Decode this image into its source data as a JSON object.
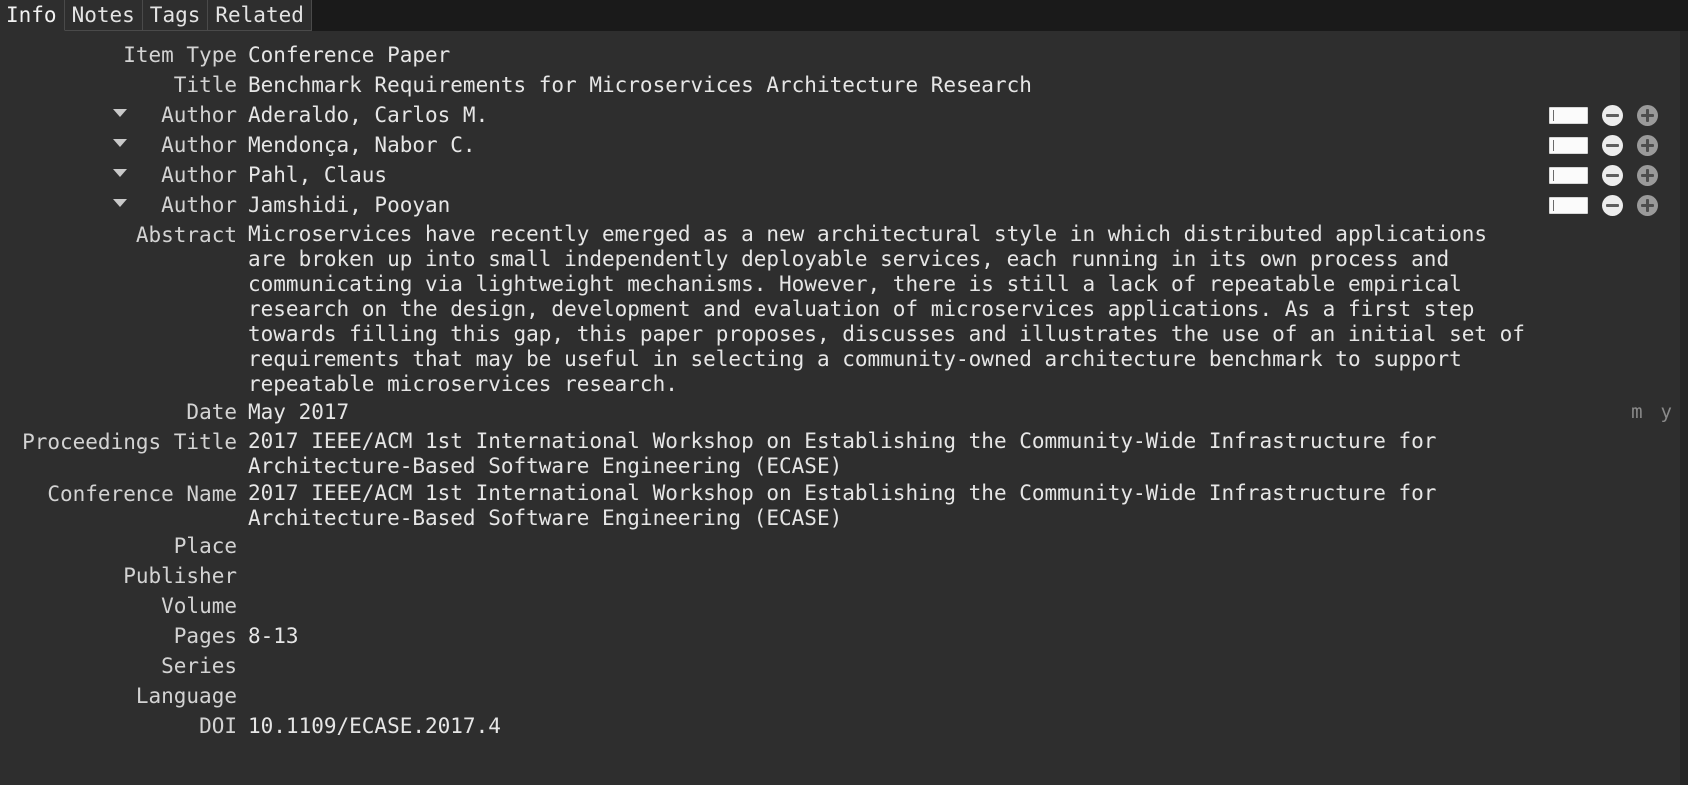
{
  "tabs": [
    {
      "label": "Info",
      "selected": true
    },
    {
      "label": "Notes",
      "selected": false
    },
    {
      "label": "Tags",
      "selected": false
    },
    {
      "label": "Related",
      "selected": false
    }
  ],
  "fields": [
    {
      "label": "Item Type",
      "value": "Conference Paper",
      "twisty": false,
      "controls": false,
      "multiline": false
    },
    {
      "label": "Title",
      "value": "Benchmark Requirements for Microservices Architecture Research",
      "twisty": false,
      "controls": false,
      "multiline": false
    },
    {
      "label": "Author",
      "value": "Aderaldo, Carlos M.",
      "twisty": true,
      "controls": true,
      "multiline": false
    },
    {
      "label": "Author",
      "value": "Mendonça, Nabor C.",
      "twisty": true,
      "controls": true,
      "multiline": false
    },
    {
      "label": "Author",
      "value": "Pahl, Claus",
      "twisty": true,
      "controls": true,
      "multiline": false
    },
    {
      "label": "Author",
      "value": "Jamshidi, Pooyan",
      "twisty": true,
      "controls": true,
      "multiline": false
    },
    {
      "label": "Abstract",
      "value": "Microservices have recently emerged as a new architectural style in which distributed applications are broken up into small independently deployable services, each running in its own process and communicating via lightweight mechanisms. However, there is still a lack of repeatable empirical research on the design, development and evaluation of microservices applications. As a first step towards filling this gap, this paper proposes, discusses and illustrates the use of an initial set of requirements that may be useful in selecting a community-owned architecture benchmark to support repeatable microservices research.",
      "twisty": false,
      "controls": false,
      "multiline": true
    },
    {
      "label": "Date",
      "value": "May 2017",
      "twisty": false,
      "controls": false,
      "multiline": false,
      "date_hints": [
        "m",
        "y"
      ]
    },
    {
      "label": "Proceedings Title",
      "value": "2017 IEEE/ACM 1st International Workshop on Establishing the Community-Wide Infrastructure for Architecture-Based Software Engineering (ECASE)",
      "twisty": false,
      "controls": false,
      "multiline": true
    },
    {
      "label": "Conference Name",
      "value": "2017 IEEE/ACM 1st International Workshop on Establishing the Community-Wide Infrastructure for Architecture-Based Software Engineering (ECASE)",
      "twisty": false,
      "controls": false,
      "multiline": true
    },
    {
      "label": "Place",
      "value": "",
      "twisty": false,
      "controls": false,
      "multiline": false
    },
    {
      "label": "Publisher",
      "value": "",
      "twisty": false,
      "controls": false,
      "multiline": false
    },
    {
      "label": "Volume",
      "value": "",
      "twisty": false,
      "controls": false,
      "multiline": false
    },
    {
      "label": "Pages",
      "value": "8-13",
      "twisty": false,
      "controls": false,
      "multiline": false
    },
    {
      "label": "Series",
      "value": "",
      "twisty": false,
      "controls": false,
      "multiline": false
    },
    {
      "label": "Language",
      "value": "",
      "twisty": false,
      "controls": false,
      "multiline": false
    },
    {
      "label": "DOI",
      "value": "10.1109/ECASE.2017.4",
      "twisty": false,
      "controls": false,
      "multiline": false
    }
  ],
  "icons": {
    "twisty": "chevron-down-icon",
    "minus": "minus-circle-icon",
    "plus": "plus-circle-icon",
    "author_field": "author-mini-input"
  },
  "colors": {
    "window_background": "#1a1a1a",
    "pane_background": "#2e2e2e",
    "label_text": "#d3d3d3",
    "value_text": "#e6e6e6",
    "hint_text": "#8a8a8a",
    "tab_border": "#4a4a4a"
  }
}
